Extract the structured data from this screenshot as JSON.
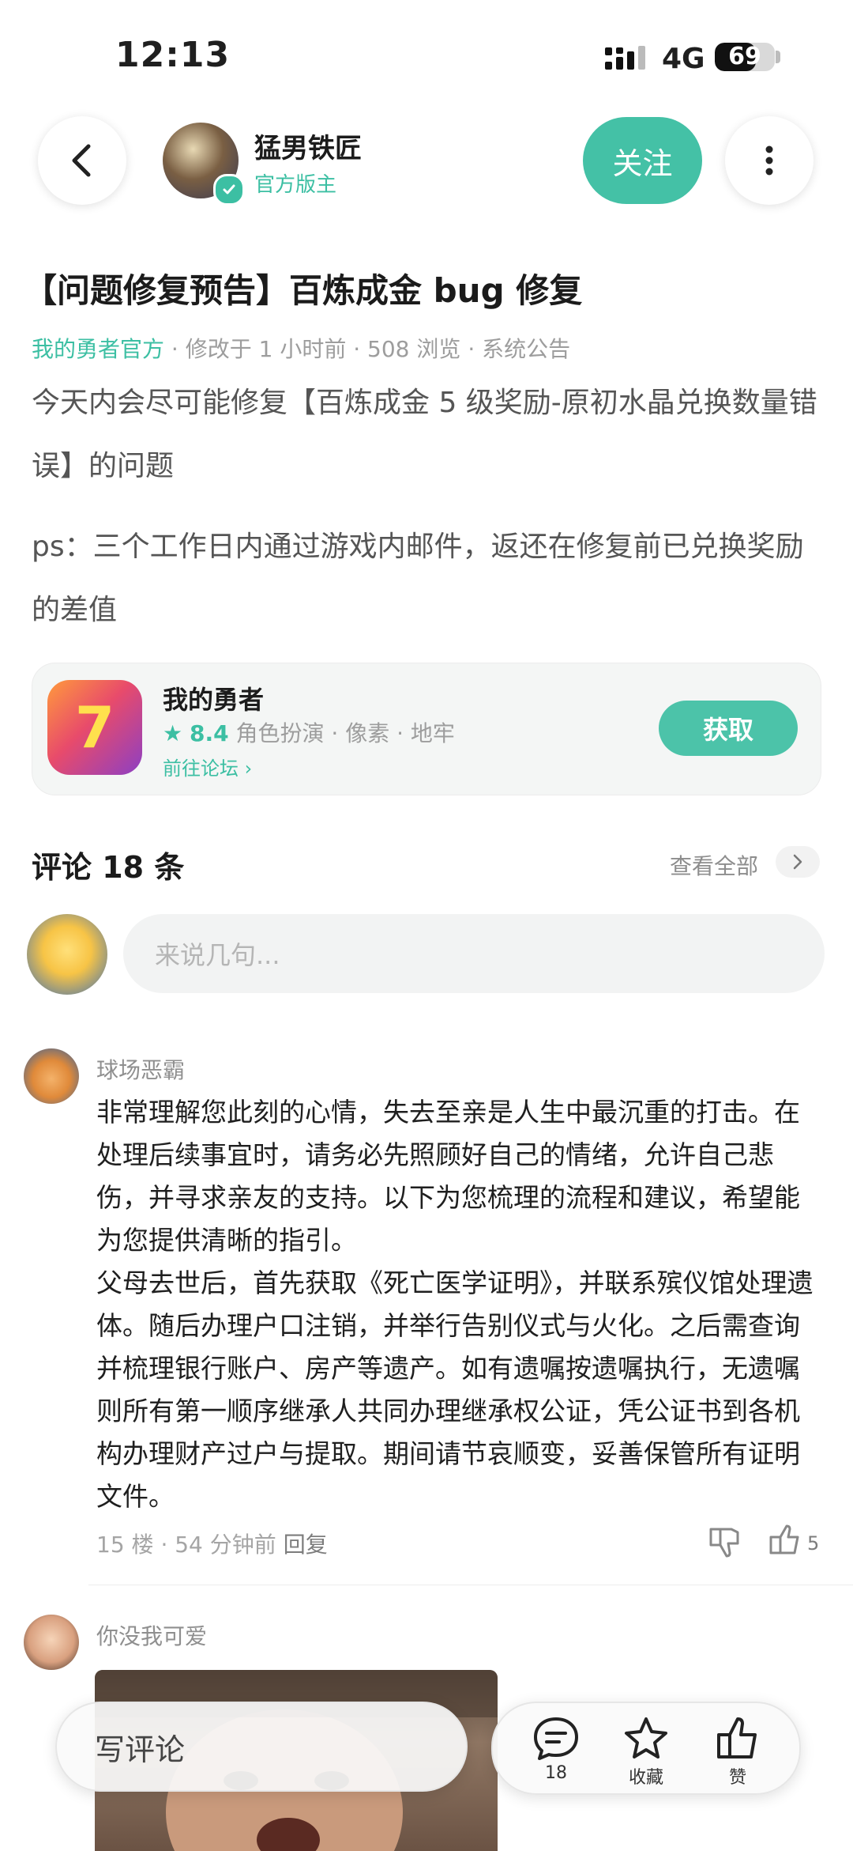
{
  "status_bar": {
    "time": "12:13",
    "network": "4G",
    "battery": "69"
  },
  "author": {
    "name": "猛男铁匠",
    "role": "官方版主",
    "follow_label": "关注"
  },
  "post": {
    "title": "【问题修复预告】百炼成金 bug 修复",
    "source": "我的勇者官方",
    "edited": "· 修改于 1 小时前",
    "views": "· 508 浏览",
    "category": "· 系统公告",
    "paragraphs": [
      "今天内会尽可能修复【百炼成金 5 级奖励-原初水晶兑换数量错误】的问题",
      "ps：三个工作日内通过游戏内邮件，返还在修复前已兑换奖励的差值"
    ]
  },
  "game_card": {
    "name": "我的勇者",
    "rating": "8.4",
    "tags": "角色扮演 · 像素 · 地牢",
    "forum_link": "前往论坛",
    "get_label": "获取"
  },
  "comments_section": {
    "title": "评论 18 条",
    "view_all": "查看全部",
    "input_placeholder": "来说几句..."
  },
  "comments": [
    {
      "user": "球场恶霸",
      "text": "非常理解您此刻的心情，失去至亲是人生中最沉重的打击。在处理后续事宜时，请务必先照顾好自己的情绪，允许自己悲伤，并寻求亲友的支持。以下为您梳理的流程和建议，希望能为您提供清晰的指引。\n父母去世后，首先获取《死亡医学证明》，并联系殡仪馆处理遗体。随后办理户口注销，并举行告别仪式与火化。之后需查询并梳理银行账户、房产等遗产。如有遗嘱按遗嘱执行，无遗嘱则所有第一顺序继承人共同办理继承权公证，凭公证书到各机构办理财产过户与提取。期间请节哀顺变，妥善保管所有证明文件。",
      "floor": "15 楼",
      "time": "· 54 分钟前",
      "reply": "回复",
      "likes": "5"
    },
    {
      "user": "你没我可爱"
    }
  ],
  "bottom_bar": {
    "write_label": "写评论",
    "comment_count": "18",
    "favorite_label": "收藏",
    "like_label": "赞"
  },
  "colors": {
    "accent": "#44c1a6",
    "text": "#1f1f1f",
    "muted": "#9d9d9d"
  }
}
